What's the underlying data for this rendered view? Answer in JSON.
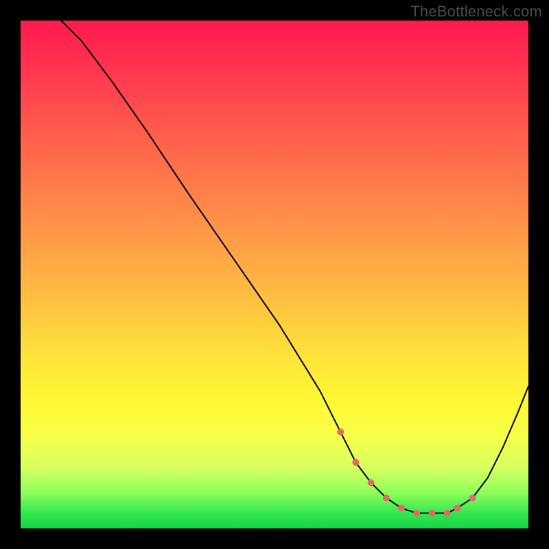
{
  "watermark": "TheBottleneck.com",
  "colors": {
    "background": "#000000",
    "watermark_text": "#4a4a4a",
    "curve": "#000000",
    "dot": "#e26a6a",
    "gradient_stops": [
      "#ff1a4d",
      "#ff564c",
      "#ff9e48",
      "#ffe33a",
      "#f7ff4a",
      "#8dff5a",
      "#14d446"
    ]
  },
  "chart_data": {
    "type": "line",
    "title": "",
    "xlabel": "",
    "ylabel": "",
    "xlim": [
      0,
      100
    ],
    "ylim": [
      0,
      100
    ],
    "note": "Axes are unlabeled; values are read as percent of plot width/height. y=0 is the bottom (green), y=100 is the top (red).",
    "series": [
      {
        "name": "curve",
        "x": [
          8,
          12,
          18,
          25,
          33,
          42,
          51,
          59,
          63,
          66,
          69,
          72,
          75,
          78,
          81,
          84,
          86,
          89,
          92,
          95,
          98,
          100
        ],
        "y": [
          100,
          96,
          88,
          78,
          66,
          53,
          40,
          27,
          19,
          13,
          9,
          6,
          4,
          3,
          3,
          3,
          4,
          6,
          10,
          16,
          23,
          28
        ]
      }
    ],
    "dots": {
      "name": "highlighted-range",
      "x": [
        63,
        66,
        69,
        72,
        75,
        78,
        81,
        84,
        86,
        89
      ],
      "y": [
        19,
        13,
        9,
        6,
        4,
        3,
        3,
        3,
        4,
        6
      ]
    }
  }
}
